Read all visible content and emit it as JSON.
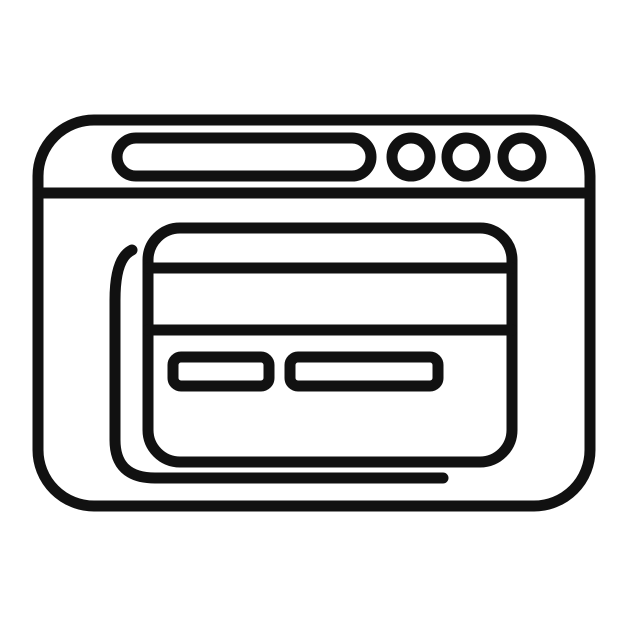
{
  "icon": {
    "name": "online-card-payment-icon",
    "parts": [
      "browser-window",
      "address-bar",
      "window-control-dots",
      "credit-card",
      "magnetic-stripe",
      "card-detail-fields",
      "card-shadow"
    ],
    "colors": {
      "background": "#ffffff",
      "stroke": "#111111"
    }
  }
}
